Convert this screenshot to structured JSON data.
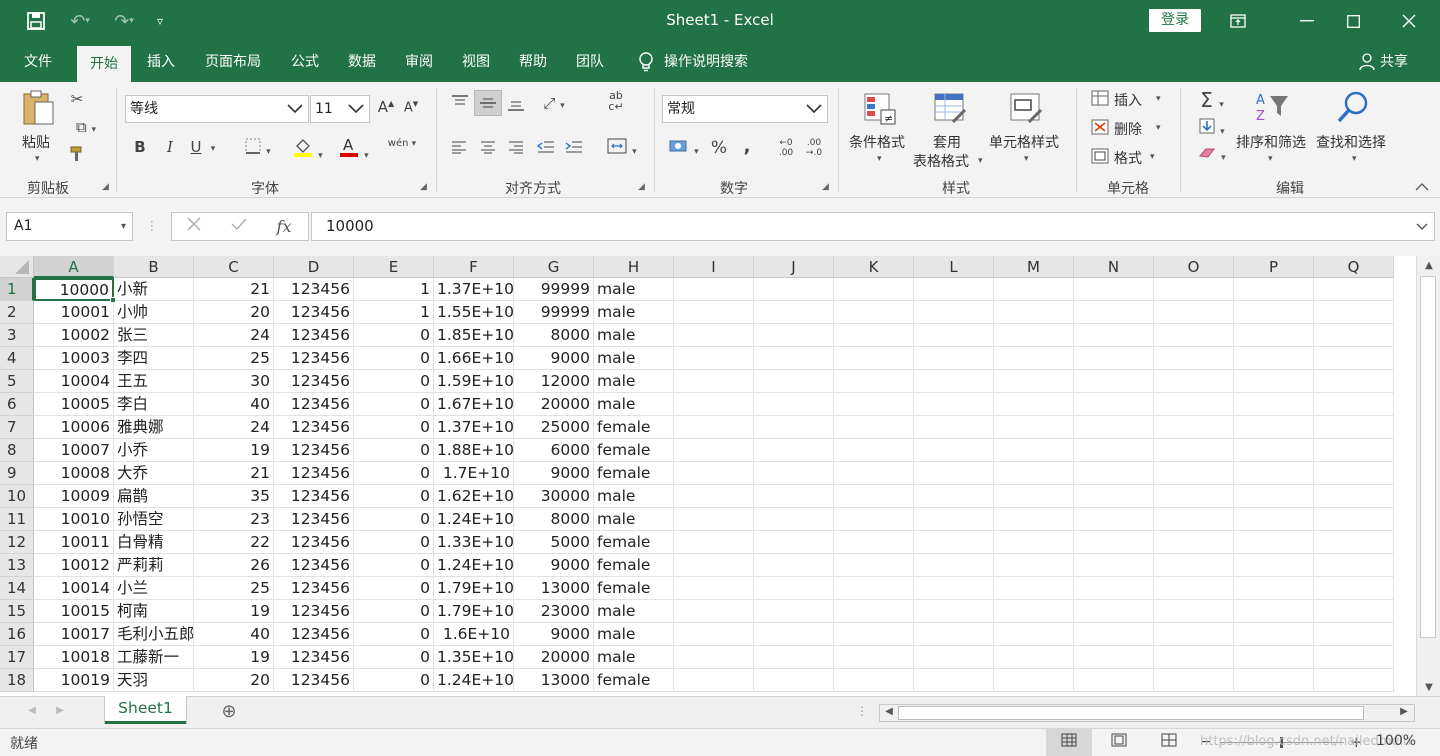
{
  "window": {
    "title": "Sheet1  -  Excel",
    "login_label": "登录",
    "accent": "#217346"
  },
  "quick_access": {
    "save_icon": "save-icon",
    "undo_icon": "undo-icon",
    "redo_icon": "redo-icon",
    "customize_icon": "customize-qat-icon"
  },
  "tabs": [
    {
      "label": "文件"
    },
    {
      "label": "开始"
    },
    {
      "label": "插入"
    },
    {
      "label": "页面布局"
    },
    {
      "label": "公式"
    },
    {
      "label": "数据"
    },
    {
      "label": "审阅"
    },
    {
      "label": "视图"
    },
    {
      "label": "帮助"
    },
    {
      "label": "团队"
    }
  ],
  "tell_me": "操作说明搜索",
  "share": "共享",
  "ribbon": {
    "clipboard": {
      "label": "剪贴板",
      "paste": "粘贴"
    },
    "font": {
      "label": "字体",
      "family": "等线",
      "size": "11",
      "bold": "B",
      "italic": "I",
      "underline": "U",
      "grow": "A",
      "shrink": "A",
      "phonetic": "wén"
    },
    "alignment": {
      "label": "对齐方式"
    },
    "number": {
      "label": "数字",
      "format": "常规",
      "percent": "%",
      "comma": ","
    },
    "styles": {
      "label": "样式",
      "conditional": "条件格式",
      "table_line1": "套用",
      "table_line2": "表格格式",
      "cell_styles": "单元格样式"
    },
    "cells": {
      "label": "单元格",
      "insert": "插入",
      "delete": "删除",
      "format": "格式"
    },
    "editing": {
      "label": "编辑",
      "sort": "排序和筛选",
      "find": "查找和选择"
    }
  },
  "formula_bar": {
    "name_box": "A1",
    "fx": "fx",
    "value": "10000"
  },
  "grid": {
    "columns": [
      "A",
      "B",
      "C",
      "D",
      "E",
      "F",
      "G",
      "H",
      "I",
      "J",
      "K",
      "L",
      "M",
      "N",
      "O",
      "P",
      "Q"
    ],
    "rows": [
      {
        "n": "1",
        "cells": [
          "10000",
          "小新",
          "21",
          "123456",
          "1",
          "1.37E+10",
          "99999",
          "male"
        ]
      },
      {
        "n": "2",
        "cells": [
          "10001",
          "小帅",
          "20",
          "123456",
          "1",
          "1.55E+10",
          "99999",
          "male"
        ]
      },
      {
        "n": "3",
        "cells": [
          "10002",
          "张三",
          "24",
          "123456",
          "0",
          "1.85E+10",
          "8000",
          "male"
        ]
      },
      {
        "n": "4",
        "cells": [
          "10003",
          "李四",
          "25",
          "123456",
          "0",
          "1.66E+10",
          "9000",
          "male"
        ]
      },
      {
        "n": "5",
        "cells": [
          "10004",
          "王五",
          "30",
          "123456",
          "0",
          "1.59E+10",
          "12000",
          "male"
        ]
      },
      {
        "n": "6",
        "cells": [
          "10005",
          "李白",
          "40",
          "123456",
          "0",
          "1.67E+10",
          "20000",
          "male"
        ]
      },
      {
        "n": "7",
        "cells": [
          "10006",
          "雅典娜",
          "24",
          "123456",
          "0",
          "1.37E+10",
          "25000",
          "female"
        ]
      },
      {
        "n": "8",
        "cells": [
          "10007",
          "小乔",
          "19",
          "123456",
          "0",
          "1.88E+10",
          "6000",
          "female"
        ]
      },
      {
        "n": "9",
        "cells": [
          "10008",
          "大乔",
          "21",
          "123456",
          "0",
          "1.7E+10",
          "9000",
          "female"
        ]
      },
      {
        "n": "10",
        "cells": [
          "10009",
          "扁鹊",
          "35",
          "123456",
          "0",
          "1.62E+10",
          "30000",
          "male"
        ]
      },
      {
        "n": "11",
        "cells": [
          "10010",
          "孙悟空",
          "23",
          "123456",
          "0",
          "1.24E+10",
          "8000",
          "male"
        ]
      },
      {
        "n": "12",
        "cells": [
          "10011",
          "白骨精",
          "22",
          "123456",
          "0",
          "1.33E+10",
          "5000",
          "female"
        ]
      },
      {
        "n": "13",
        "cells": [
          "10012",
          "严莉莉",
          "26",
          "123456",
          "0",
          "1.24E+10",
          "9000",
          "female"
        ]
      },
      {
        "n": "14",
        "cells": [
          "10014",
          "小兰",
          "25",
          "123456",
          "0",
          "1.79E+10",
          "13000",
          "female"
        ]
      },
      {
        "n": "15",
        "cells": [
          "10015",
          "柯南",
          "19",
          "123456",
          "0",
          "1.79E+10",
          "23000",
          "male"
        ]
      },
      {
        "n": "16",
        "cells": [
          "10017",
          "毛利小五郎",
          "40",
          "123456",
          "0",
          "1.6E+10",
          "9000",
          "male"
        ]
      },
      {
        "n": "17",
        "cells": [
          "10018",
          "工藤新一",
          "19",
          "123456",
          "0",
          "1.35E+10",
          "20000",
          "male"
        ]
      },
      {
        "n": "18",
        "cells": [
          "10019",
          "天羽",
          "20",
          "123456",
          "0",
          "1.24E+10",
          "13000",
          "female"
        ]
      }
    ]
  },
  "sheets": [
    {
      "label": "Sheet1"
    }
  ],
  "status": {
    "ready": "就绪",
    "zoom": "100%",
    "watermark": "https://blog.csdn.net/nailedmeln"
  }
}
